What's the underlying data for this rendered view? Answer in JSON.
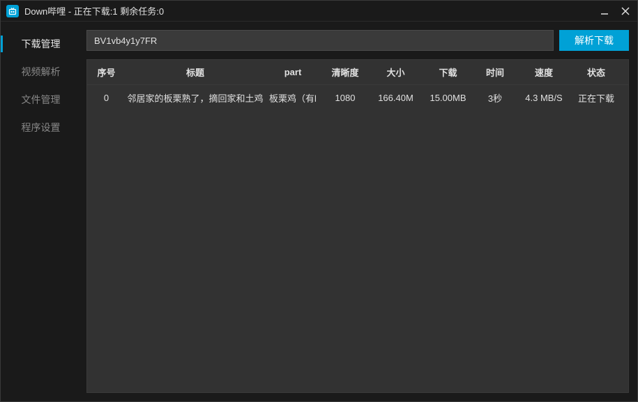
{
  "titlebar": {
    "text": "Down哔哩 - 正在下载:1  剩余任务:0"
  },
  "sidebar": {
    "items": [
      {
        "label": "下载管理",
        "active": true
      },
      {
        "label": "视频解析",
        "active": false
      },
      {
        "label": "文件管理",
        "active": false
      },
      {
        "label": "程序设置",
        "active": false
      }
    ]
  },
  "input": {
    "value": "BV1vb4y1y7FR"
  },
  "buttons": {
    "parse": "解析下载"
  },
  "table": {
    "headers": {
      "index": "序号",
      "title": "标题",
      "part": "part",
      "quality": "清晰度",
      "size": "大小",
      "download": "下载",
      "time": "时间",
      "speed": "速度",
      "status": "状态"
    },
    "rows": [
      {
        "index": "0",
        "title": "邻居家的板栗熟了，摘回家和土鸡",
        "part": "板栗鸡（有l",
        "quality": "1080",
        "size": "166.40M",
        "download": "15.00MB",
        "time": "3秒",
        "speed": "4.3 MB/S",
        "status": "正在下载"
      }
    ]
  }
}
